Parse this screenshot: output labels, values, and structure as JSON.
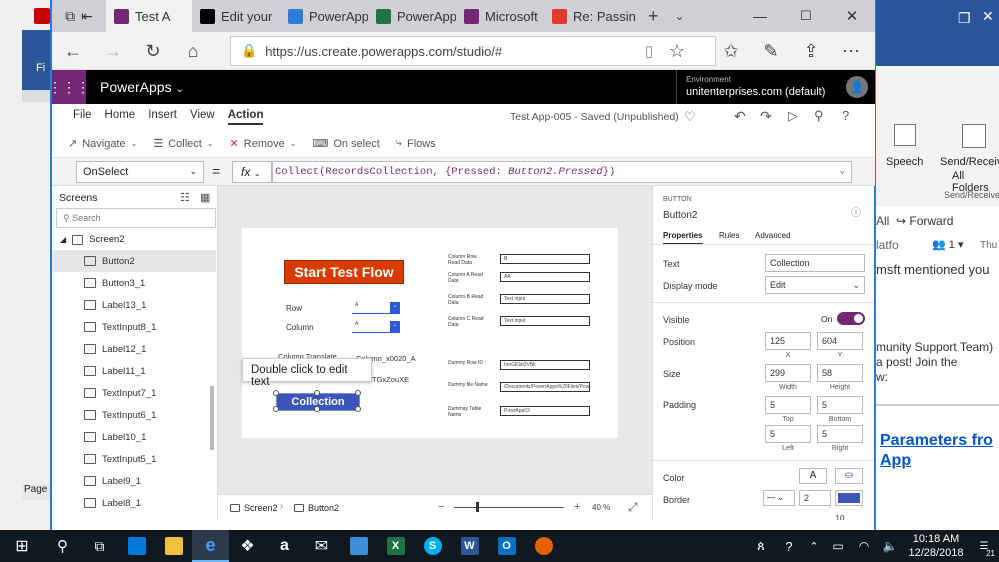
{
  "browser": {
    "tabs": [
      {
        "label": "Test A",
        "color": "#742774",
        "active": true
      },
      {
        "label": "Edit your",
        "color": "#000000"
      },
      {
        "label": "PowerApp",
        "color": "#2f7bd6"
      },
      {
        "label": "PowerApp",
        "color": "#217346"
      },
      {
        "label": "Microsoft",
        "color": "#742774"
      },
      {
        "label": "Re: Passin",
        "color": "#e0392d"
      }
    ],
    "url": "https://us.create.powerapps.com/studio/#"
  },
  "app": {
    "brand": "PowerApps",
    "environment_label": "Environment",
    "environment_value": "unitenterprises.com (default)",
    "app_status": "Test App-005 - Saved (Unpublished)"
  },
  "menus": [
    "File",
    "Home",
    "Insert",
    "View",
    "Action"
  ],
  "toolbar": {
    "navigate": "Navigate",
    "collect": "Collect",
    "remove": "Remove",
    "onselect": "On select",
    "flows": "Flows"
  },
  "formula": {
    "property": "OnSelect",
    "fx": "fx",
    "part1": "Collect(RecordsCollection, {Pressed: ",
    "part2": "Button2.Pressed",
    "part3": "})"
  },
  "left_pane": {
    "title": "Screens",
    "search_placeholder": "Search",
    "screen": "Screen2",
    "items": [
      "Button2",
      "Button3_1",
      "Label13_1",
      "TextInput8_1",
      "Label12_1",
      "Label11_1",
      "TextInput7_1",
      "TextInput6_1",
      "Label10_1",
      "TextInput5_1",
      "Label9_1",
      "Label8_1"
    ]
  },
  "canvas": {
    "start_button": "Start Test Flow",
    "row_label": "Row",
    "column_label": "Column",
    "row_value": "A",
    "column_value": "A",
    "col_translate": "Column Translate",
    "col_translate_value": "Column_x0020_A",
    "hidden_value": "TGxZouXE",
    "tooltip": "Double click to edit text",
    "collection_button": "Collection",
    "right_labels": [
      "Column Row Read Data",
      "Column A Read Data",
      "Column B Read Data",
      "Column C Read Data",
      "Dummy Row ID",
      "Dummy file Name",
      "Dummay Table Name"
    ],
    "right_values": [
      "B",
      "AA",
      "Text input",
      "Text input",
      "hnrGKbit3VBk",
      "/Documents/PowerApps%20Files/Power",
      "PowrApp02"
    ]
  },
  "status": {
    "screen": "Screen2",
    "control": "Button2",
    "zoom": "40",
    "zoom_unit": "%"
  },
  "props": {
    "type": "BUTTON",
    "name": "Button2",
    "tabs": [
      "Properties",
      "Rules",
      "Advanced"
    ],
    "text_label": "Text",
    "text_value": "Collection",
    "display_label": "Display mode",
    "display_value": "Edit",
    "visible_label": "Visible",
    "visible_value": "On",
    "position_label": "Position",
    "pos_x": "125",
    "pos_y": "604",
    "x_cap": "X",
    "y_cap": "Y",
    "size_label": "Size",
    "width": "299",
    "height": "58",
    "width_cap": "Width",
    "height_cap": "Height",
    "padding_label": "Padding",
    "top": "5",
    "bottom": "5",
    "left": "5",
    "right": "5",
    "top_cap": "Top",
    "bottom_cap": "Bottom",
    "left_cap": "Left",
    "right_cap": "Right",
    "color_label": "Color",
    "color_a": "A",
    "border_label": "Border",
    "border_value": "2",
    "next_value": "10"
  },
  "outlook": {
    "speech": "Speech",
    "send_receive": "Send/Receive",
    "all_folders": "All Folders",
    "send_receive2": "Send/Receive",
    "all": "All",
    "forward": "Forward",
    "platform": "latfo",
    "people_count": "1",
    "thu": "Thu",
    "mentioned": "msft mentioned you",
    "support1": "munity Support Team)",
    "support2": "a post! Join the",
    "support3": "w:",
    "link1": "Parameters fro",
    "link2": "App"
  },
  "taskbar": {
    "time": "10:18 AM",
    "date": "12/28/2018",
    "notifications": "21"
  },
  "colors": {
    "accent": "#742774",
    "start_button": "#d83b01",
    "collection_button": "#3a56b8",
    "taskbar": "#101820",
    "link": "#0055cc"
  }
}
